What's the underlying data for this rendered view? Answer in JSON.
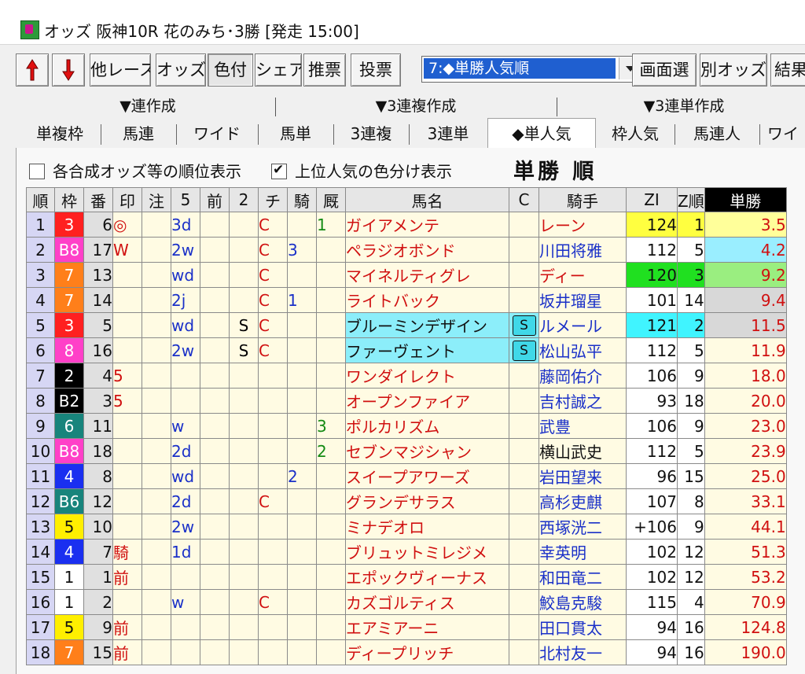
{
  "window": {
    "title": "オッズ 阪神10R 花のみち･3勝 [発走 15:00]"
  },
  "toolbar": {
    "buttons": [
      "他レース",
      "オッズ",
      "色付",
      "シェア",
      "推票",
      "投票",
      "画面選",
      "別オッズ",
      "結果"
    ],
    "up_arrow": "up-arrow-icon",
    "down_arrow": "down-arrow-icon",
    "dropdown_value": "7:◆単勝人気順"
  },
  "groups": [
    "▼連作成",
    "▼3連複作成",
    "▼3連単作成"
  ],
  "tabs": [
    "単複枠",
    "馬連",
    "ワイド",
    "馬単",
    "3連複",
    "3連単",
    "◆単人気",
    "枠人気",
    "馬連人",
    "ワイ"
  ],
  "options": {
    "opt1": "各合成オッズ等の順位表示",
    "opt2": "上位人気の色分け表示",
    "heading": "単勝 順"
  },
  "colors": {
    "waku": {
      "1": "#ffffff",
      "2": "#000000",
      "3": "#ff2020",
      "4": "#1a2ff0",
      "5": "#ffef00",
      "6": "#18847c",
      "7": "#ff7f1a",
      "8": "#ff40c8"
    },
    "zi_top1": "#ffff40",
    "zi_top2": "#40f4ff",
    "zi_top3": "#20e020",
    "odds_rank1": "#ffff9a",
    "odds_rank2": "#9aeeff",
    "odds_rank3": "#9aee80",
    "odds_rank4_5": "#d8d8d8"
  },
  "table": {
    "headers": [
      "順",
      "枠",
      "番",
      "印",
      "注",
      "5",
      "前",
      "2",
      "チ",
      "騎",
      "厩",
      "馬名",
      "C",
      "騎手",
      "ZI",
      "Z順",
      "単勝"
    ],
    "rows": [
      {
        "rank": "1",
        "waku": "3",
        "wc": "3",
        "num": "6",
        "mark": "◎",
        "chu": "",
        "f5": "3d",
        "mae": "",
        "n2": "",
        "chi": "C",
        "ki": "",
        "kyu": "1",
        "name": "ガイアメンテ",
        "c": "",
        "jockey": "レーン",
        "jred": true,
        "zi": "124",
        "zr": "1",
        "odds": "3.5",
        "zc": "zi_top1",
        "oc": "odds_rank1"
      },
      {
        "rank": "2",
        "waku": "B8",
        "wc": "8",
        "num": "17",
        "mark": "W",
        "chu": "",
        "f5": "2w",
        "mae": "",
        "n2": "",
        "chi": "C",
        "ki": "3",
        "kyu": "",
        "name": "ペラジオボンド",
        "c": "",
        "jockey": "川田将雅",
        "jred": false,
        "zi": "112",
        "zr": "5",
        "odds": "4.2",
        "zc": "",
        "oc": "odds_rank2"
      },
      {
        "rank": "3",
        "waku": "7",
        "wc": "7",
        "num": "13",
        "mark": "",
        "chu": "",
        "f5": "wd",
        "mae": "",
        "n2": "",
        "chi": "C",
        "ki": "",
        "kyu": "",
        "name": "マイネルティグレ",
        "c": "",
        "jockey": "ディー",
        "jred": true,
        "zi": "120",
        "zr": "3",
        "odds": "9.2",
        "zc": "zi_top3",
        "oc": "odds_rank3"
      },
      {
        "rank": "4",
        "waku": "7",
        "wc": "7",
        "num": "14",
        "mark": "",
        "chu": "",
        "f5": "2j",
        "mae": "",
        "n2": "",
        "chi": "C",
        "ki": "1",
        "kyu": "",
        "name": "ライトバック",
        "c": "",
        "jockey": "坂井瑠星",
        "jred": false,
        "zi": "101",
        "zr": "14",
        "odds": "9.4",
        "zc": "",
        "oc": "odds_rank4_5"
      },
      {
        "rank": "5",
        "waku": "3",
        "wc": "3",
        "num": "5",
        "mark": "",
        "chu": "",
        "f5": "wd",
        "mae": "",
        "n2": "S",
        "chi": "C",
        "ki": "",
        "kyu": "",
        "name": "ブルーミンデザイン",
        "c": "S",
        "jockey": "ルメール",
        "jred": false,
        "zi": "121",
        "zr": "2",
        "odds": "11.5",
        "zc": "zi_top2",
        "oc": "odds_rank4_5",
        "cyan": true
      },
      {
        "rank": "6",
        "waku": "8",
        "wc": "8",
        "num": "16",
        "mark": "",
        "chu": "",
        "f5": "2w",
        "mae": "",
        "n2": "S",
        "chi": "C",
        "ki": "",
        "kyu": "",
        "name": "ファーヴェント",
        "c": "S",
        "jockey": "松山弘平",
        "jred": false,
        "zi": "112",
        "zr": "5",
        "odds": "11.9",
        "zc": "",
        "oc": "",
        "cyan": true
      },
      {
        "rank": "7",
        "waku": "2",
        "wc": "2",
        "num": "4",
        "mark": "5",
        "chu": "",
        "f5": "",
        "mae": "",
        "n2": "",
        "chi": "",
        "ki": "",
        "kyu": "",
        "name": "ワンダイレクト",
        "c": "",
        "jockey": "藤岡佑介",
        "jred": false,
        "zi": "106",
        "zr": "9",
        "odds": "18.0",
        "zc": "",
        "oc": ""
      },
      {
        "rank": "8",
        "waku": "B2",
        "wc": "2",
        "num": "3",
        "mark": "5",
        "chu": "",
        "f5": "",
        "mae": "",
        "n2": "",
        "chi": "",
        "ki": "",
        "kyu": "",
        "name": "オープンファイア",
        "c": "",
        "jockey": "吉村誠之",
        "jred": false,
        "zi": "93",
        "zr": "18",
        "odds": "20.0",
        "zc": "",
        "oc": ""
      },
      {
        "rank": "9",
        "waku": "6",
        "wc": "6",
        "num": "11",
        "mark": "",
        "chu": "",
        "f5": "w",
        "mae": "",
        "n2": "",
        "chi": "",
        "ki": "",
        "kyu": "3",
        "name": "ポルカリズム",
        "c": "",
        "jockey": "武豊",
        "jred": false,
        "zi": "106",
        "zr": "9",
        "odds": "23.0",
        "zc": "",
        "oc": ""
      },
      {
        "rank": "10",
        "waku": "B8",
        "wc": "8",
        "num": "18",
        "mark": "",
        "chu": "",
        "f5": "2d",
        "mae": "",
        "n2": "",
        "chi": "",
        "ki": "",
        "kyu": "2",
        "name": "セブンマジシャン",
        "c": "",
        "jockey": "横山武史",
        "jred": false,
        "jblack": true,
        "zi": "112",
        "zr": "5",
        "odds": "23.9",
        "zc": "",
        "oc": ""
      },
      {
        "rank": "11",
        "waku": "4",
        "wc": "4",
        "num": "8",
        "mark": "",
        "chu": "",
        "f5": "wd",
        "mae": "",
        "n2": "",
        "chi": "",
        "ki": "2",
        "kyu": "",
        "name": "スイープアワーズ",
        "c": "",
        "jockey": "岩田望来",
        "jred": false,
        "zi": "96",
        "zr": "15",
        "odds": "25.0",
        "zc": "",
        "oc": ""
      },
      {
        "rank": "12",
        "waku": "B6",
        "wc": "6",
        "num": "12",
        "mark": "",
        "chu": "",
        "f5": "2d",
        "mae": "",
        "n2": "",
        "chi": "C",
        "ki": "",
        "kyu": "",
        "name": "グランデサラス",
        "c": "",
        "jockey": "高杉吏麒",
        "jred": false,
        "zi": "107",
        "zr": "8",
        "odds": "33.1",
        "zc": "",
        "oc": ""
      },
      {
        "rank": "13",
        "waku": "5",
        "wc": "5",
        "num": "10",
        "mark": "",
        "chu": "",
        "f5": "2w",
        "mae": "",
        "n2": "",
        "chi": "",
        "ki": "",
        "kyu": "",
        "name": "ミナデオロ",
        "c": "",
        "jockey": "西塚洸二",
        "jred": false,
        "zi": "+106",
        "zr": "9",
        "odds": "44.1",
        "zc": "",
        "oc": ""
      },
      {
        "rank": "14",
        "waku": "4",
        "wc": "4",
        "num": "7",
        "mark": "騎",
        "chu": "",
        "f5": "1d",
        "mae": "",
        "n2": "",
        "chi": "",
        "ki": "",
        "kyu": "",
        "name": "ブリュットミレジメ",
        "c": "",
        "jockey": "幸英明",
        "jred": false,
        "zi": "102",
        "zr": "12",
        "odds": "51.3",
        "zc": "",
        "oc": ""
      },
      {
        "rank": "15",
        "waku": "1",
        "wc": "1",
        "num": "1",
        "mark": "前",
        "chu": "",
        "f5": "",
        "mae": "",
        "n2": "",
        "chi": "",
        "ki": "",
        "kyu": "",
        "name": "エポックヴィーナス",
        "c": "",
        "jockey": "和田竜二",
        "jred": false,
        "zi": "102",
        "zr": "12",
        "odds": "53.2",
        "zc": "",
        "oc": ""
      },
      {
        "rank": "16",
        "waku": "1",
        "wc": "1",
        "num": "2",
        "mark": "",
        "chu": "",
        "f5": "w",
        "mae": "",
        "n2": "",
        "chi": "C",
        "ki": "",
        "kyu": "",
        "name": "カズゴルティス",
        "c": "",
        "jockey": "鮫島克駿",
        "jred": false,
        "zi": "115",
        "zr": "4",
        "odds": "70.9",
        "zc": "",
        "oc": ""
      },
      {
        "rank": "17",
        "waku": "5",
        "wc": "5",
        "num": "9",
        "mark": "前",
        "chu": "",
        "f5": "",
        "mae": "",
        "n2": "",
        "chi": "",
        "ki": "",
        "kyu": "",
        "name": "エアミアーニ",
        "c": "",
        "jockey": "田口貫太",
        "jred": false,
        "zi": "94",
        "zr": "16",
        "odds": "124.8",
        "zc": "",
        "oc": ""
      },
      {
        "rank": "18",
        "waku": "7",
        "wc": "7",
        "num": "15",
        "mark": "前",
        "chu": "",
        "f5": "",
        "mae": "",
        "n2": "",
        "chi": "",
        "ki": "",
        "kyu": "",
        "name": "ディープリッチ",
        "c": "",
        "jockey": "北村友一",
        "jred": false,
        "zi": "94",
        "zr": "16",
        "odds": "190.0",
        "zc": "",
        "oc": ""
      }
    ]
  }
}
